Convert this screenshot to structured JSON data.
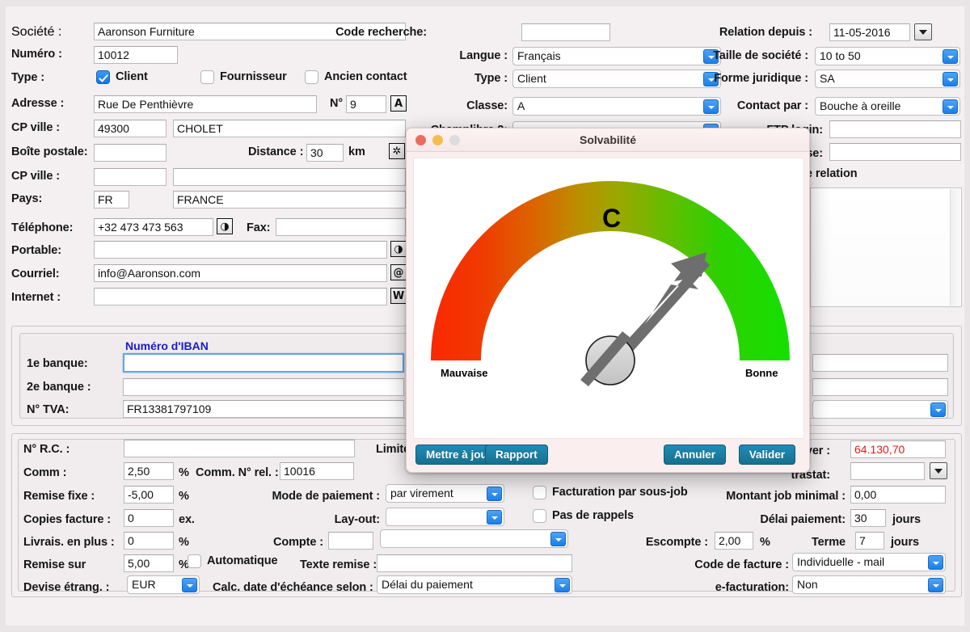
{
  "window": {
    "background_color": "#f4f0f1"
  },
  "left_column": {
    "societe_label": "Société :",
    "societe_value": "Aaronson Furniture",
    "numero_label": "Numéro :",
    "numero_value": "10012",
    "type_label": "Type :",
    "type_client_label": "Client",
    "type_client_checked": true,
    "type_fournisseur_label": "Fournisseur",
    "type_fournisseur_checked": false,
    "type_ancien_label": "Ancien contact",
    "type_ancien_checked": false,
    "adresse_label": "Adresse :",
    "adresse_value": "Rue De Penthièvre",
    "numero_rue_label": "N°",
    "numero_rue_value": "9",
    "adresse_icon": "A",
    "cp_ville_label": "CP ville :",
    "cp_value": "49300",
    "ville_value": "CHOLET",
    "boite_postale_label": "Boîte postale:",
    "boite_postale_value": "",
    "distance_label": "Distance :",
    "distance_value": "30",
    "distance_unit": "km",
    "cp_ville2_label": "CP ville :",
    "cp2_value": "",
    "ville2_value": "",
    "pays_label": "Pays:",
    "pays_code": "FR",
    "pays_name": "FRANCE",
    "telephone_label": "Téléphone:",
    "telephone_value": "+32 473 473 563",
    "fax_label": "Fax:",
    "fax_value": "",
    "portable_label": "Portable:",
    "portable_value": "",
    "courriel_label": "Courriel:",
    "courriel_value": "info@Aaronson.com",
    "internet_label": "Internet :",
    "internet_value": ""
  },
  "bank_panel": {
    "iban_header": "Numéro d'IBAN",
    "banque1_label": "1e banque:",
    "banque1_value": "",
    "banque2_label": "2e banque :",
    "banque2_value": "",
    "tva_label": "N° TVA:",
    "tva_value": "FR13381797109"
  },
  "right_column": {
    "code_recherche_label": "Code recherche:",
    "code_recherche_value": "",
    "relation_depuis_label": "Relation depuis :",
    "relation_depuis_value": "11-05-2016",
    "langue_label": "Langue :",
    "langue_value": "Français",
    "taille_societe_label": "Taille de société :",
    "taille_societe_value": "10 to 50",
    "type_label": "Type :",
    "type_value": "Client",
    "forme_juridique_label": "Forme juridique :",
    "forme_juridique_value": "SA",
    "classe_label": "Classe:",
    "classe_value": "A",
    "contact_par_label": "Contact par :",
    "contact_par_value": "Bouche à oreille",
    "champlibre2_label": "Champlibre 2:",
    "champlibre2_value": "",
    "ftp_login_label": "FTP login:",
    "ftp_login_value": "",
    "ftp_password_label": "se:",
    "ftp_password_value": "",
    "relation_note_label": "e relation"
  },
  "dialog": {
    "title": "Solvabilité",
    "traffic_lights": [
      {
        "name": "close",
        "color": "#ed6a5e"
      },
      {
        "name": "minimize",
        "color": "#f5bd4f"
      },
      {
        "name": "zoom",
        "color": "#dcdcdc"
      }
    ],
    "buttons": {
      "mettre_a_jour": "Mettre à jour",
      "rapport": "Rapport",
      "annuler": "Annuler",
      "valider": "Valider"
    },
    "accent_color": "#16718f"
  },
  "chart_data": {
    "type": "gauge",
    "title": "Solvabilité",
    "grade": "C",
    "min_label": "Mauvaise",
    "max_label": "Bonne",
    "value": 0.72,
    "value_min": 0,
    "value_max": 1,
    "needle_angle_deg": 49,
    "arc_start_angle_deg": 180,
    "arc_end_angle_deg": 0,
    "gradient_stops": [
      {
        "position": 0.0,
        "color": "#fa2800"
      },
      {
        "position": 0.25,
        "color": "#e06000"
      },
      {
        "position": 0.5,
        "color": "#a8a000"
      },
      {
        "position": 0.75,
        "color": "#52c000"
      },
      {
        "position": 1.0,
        "color": "#16dd00"
      }
    ],
    "needle_color": "#6e6e6e",
    "hub_color": "#cfcfcf",
    "grid": false,
    "legend": "none"
  },
  "commercial_panel": {
    "nrc_label": "N° R.C. :",
    "nrc_value": "",
    "limite_label": "Limite",
    "comm_label": "Comm :",
    "comm_value": "2,50",
    "comm_unit": "%",
    "comm_nrel_label": "Comm. N° rel. :",
    "comm_nrel_value": "10016",
    "remise_fixe_label": "Remise fixe :",
    "remise_fixe_value": "-5,00",
    "remise_fixe_unit": "%",
    "mode_paiement_label": "Mode de paiement :",
    "mode_paiement_value": "par virement",
    "copies_facture_label": "Copies facture :",
    "copies_facture_value": "0",
    "copies_facture_unit": "ex.",
    "layout_label": "Lay-out:",
    "layout_value": "",
    "livrais_label": "Livrais. en plus :",
    "livrais_value": "0",
    "livrais_unit": "%",
    "compte_label": "Compte :",
    "compte_value": "",
    "compte_value2": "",
    "remise_sur_label": "Remise sur",
    "remise_sur_value": "5,00",
    "remise_sur_unit": "%",
    "automatique_label": "Automatique",
    "automatique_checked": false,
    "texte_remise_label": "Texte remise :",
    "texte_remise_value": "",
    "devise_label": "Devise étrang. :",
    "devise_value": "EUR",
    "calc_date_label": "Calc. date d'échéance selon :",
    "calc_date_value": "Délai du paiement",
    "facturation_sous_job_label": "Facturation par sous-job",
    "facturation_sous_job_checked": false,
    "pas_de_rappels_label": "Pas de rappels",
    "pas_de_rappels_checked": false,
    "a_payer_label": "payer :",
    "a_payer_value": "64.130,70",
    "intrastat_label": "trastat:",
    "intrastat_value": "",
    "montant_job_label": "Montant job minimal :",
    "montant_job_value": "0,00",
    "delai_paiement_label": "Délai paiement:",
    "delai_paiement_value": "30",
    "delai_paiement_unit": "jours",
    "escompte_label": "Escompte :",
    "escompte_value": "2,00",
    "escompte_unit": "%",
    "terme_label": "Terme",
    "terme_value": "7",
    "terme_unit": "jours",
    "code_facture_label": "Code de facture :",
    "code_facture_value": "Individuelle - mail",
    "efacturation_label": "e-facturation:",
    "efacturation_value": "Non"
  },
  "icons": {
    "phone": "◑",
    "email": "@",
    "web": "W",
    "address": "A",
    "map": "✲"
  }
}
